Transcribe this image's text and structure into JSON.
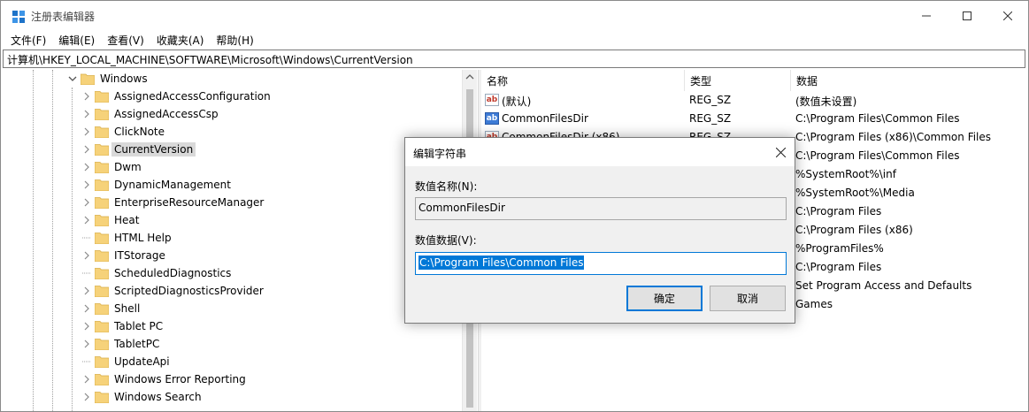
{
  "window": {
    "title": "注册表编辑器",
    "controls": {
      "minimize": "minimize",
      "maximize": "maximize",
      "close": "close"
    }
  },
  "menu": [
    "文件(F)",
    "编辑(E)",
    "查看(V)",
    "收藏夹(A)",
    "帮助(H)"
  ],
  "address": "计算机\\HKEY_LOCAL_MACHINE\\SOFTWARE\\Microsoft\\Windows\\CurrentVersion",
  "tree": {
    "parent": "Windows",
    "children": [
      {
        "label": "AssignedAccessConfiguration",
        "expandable": true
      },
      {
        "label": "AssignedAccessCsp",
        "expandable": true
      },
      {
        "label": "ClickNote",
        "expandable": true
      },
      {
        "label": "CurrentVersion",
        "expandable": true,
        "selected": true
      },
      {
        "label": "Dwm",
        "expandable": true
      },
      {
        "label": "DynamicManagement",
        "expandable": true
      },
      {
        "label": "EnterpriseResourceManager",
        "expandable": true
      },
      {
        "label": "Heat",
        "expandable": true
      },
      {
        "label": "HTML Help",
        "expandable": false
      },
      {
        "label": "ITStorage",
        "expandable": true
      },
      {
        "label": "ScheduledDiagnostics",
        "expandable": false
      },
      {
        "label": "ScriptedDiagnosticsProvider",
        "expandable": true
      },
      {
        "label": "Shell",
        "expandable": true
      },
      {
        "label": "Tablet PC",
        "expandable": true
      },
      {
        "label": "TabletPC",
        "expandable": true
      },
      {
        "label": "UpdateApi",
        "expandable": false
      },
      {
        "label": "Windows Error Reporting",
        "expandable": true
      },
      {
        "label": "Windows Search",
        "expandable": true
      }
    ]
  },
  "values": {
    "headers": {
      "name": "名称",
      "type": "类型",
      "data": "数据"
    },
    "rows": [
      {
        "name": "(默认)",
        "type": "REG_SZ",
        "data": "(数值未设置)",
        "icon": "ab"
      },
      {
        "name": "CommonFilesDir",
        "type": "REG_SZ",
        "data": "C:\\Program Files\\Common Files",
        "icon": "ab-selected"
      },
      {
        "name": "CommonFilesDir (x86)",
        "type": "REG_SZ",
        "data": "C:\\Program Files (x86)\\Common Files",
        "icon": "ab"
      },
      {
        "name": "",
        "type": "",
        "data": "C:\\Program Files\\Common Files",
        "icon": ""
      },
      {
        "name": "",
        "type": "",
        "data": "%SystemRoot%\\inf",
        "icon": ""
      },
      {
        "name": "",
        "type": "",
        "data": "%SystemRoot%\\Media",
        "icon": ""
      },
      {
        "name": "",
        "type": "",
        "data": "C:\\Program Files",
        "icon": ""
      },
      {
        "name": "",
        "type": "",
        "data": "C:\\Program Files (x86)",
        "icon": ""
      },
      {
        "name": "",
        "type": "",
        "data": "%ProgramFiles%",
        "icon": ""
      },
      {
        "name": "",
        "type": "",
        "data": "C:\\Program Files",
        "icon": ""
      },
      {
        "name": "",
        "type": "",
        "data": "Set Program Access and Defaults",
        "icon": ""
      },
      {
        "name": "",
        "type": "",
        "data": "Games",
        "icon": ""
      }
    ]
  },
  "dialog": {
    "title": "编辑字符串",
    "name_label": "数值名称(N):",
    "name_value": "CommonFilesDir",
    "data_label": "数值数据(V):",
    "data_value": "C:\\Program Files\\Common Files",
    "ok_label": "确定",
    "cancel_label": "取消"
  },
  "colors": {
    "accent": "#0078d7",
    "selection": "#d9d9d9",
    "folder": "#f6d27a"
  }
}
